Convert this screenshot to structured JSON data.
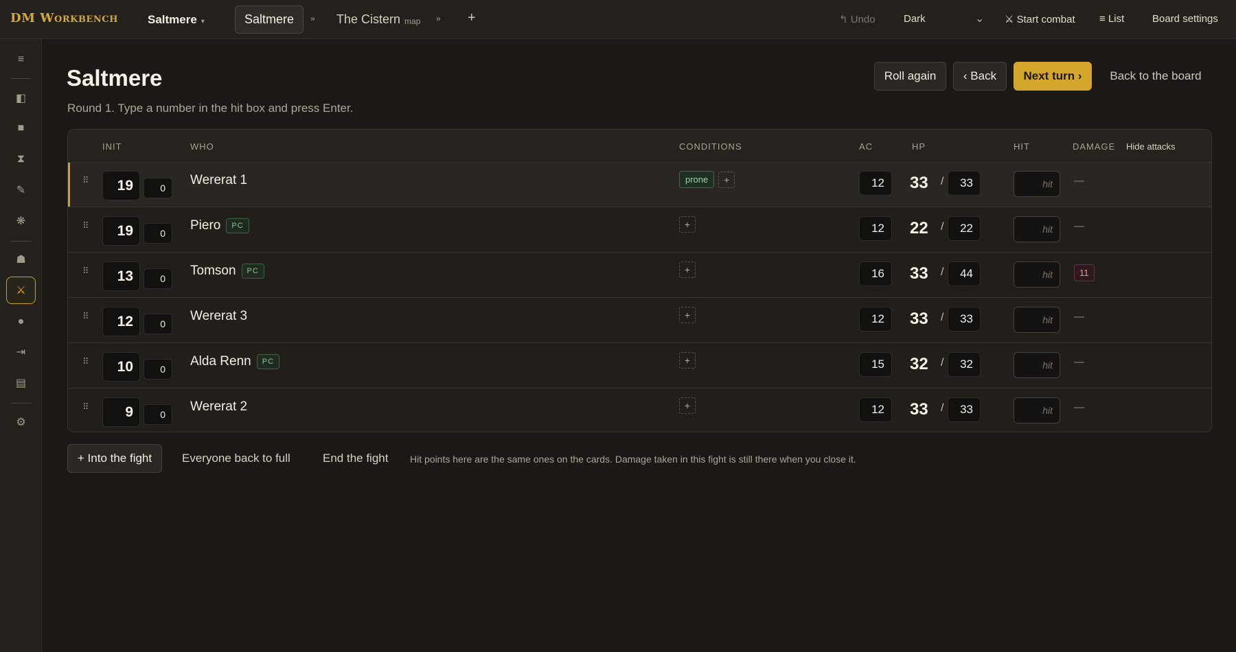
{
  "topbar": {
    "brand": "DM Workbench",
    "campaign": "Saltmere",
    "tabs": [
      {
        "label": "Saltmere",
        "sub": ""
      },
      {
        "label": "The Cistern",
        "sub": "map"
      }
    ],
    "undo": "Undo",
    "theme": "Dark",
    "start_combat": "Start combat",
    "list": "List",
    "board_settings": "Board settings"
  },
  "sidebar": {
    "items": [
      "menu-icon",
      "panel-icon",
      "square-icon",
      "hourglass-icon",
      "pencil-icon",
      "sparkle-icon",
      "helmet-icon",
      "swords-icon",
      "dot-icon",
      "arrow-to-bar-icon",
      "notes-icon",
      "gear-icon"
    ],
    "active": "swords-icon"
  },
  "header": {
    "title": "Saltmere",
    "subtitle": "Round 1. Type a number in the hit box and press Enter.",
    "roll_again": "Roll again",
    "back": "‹ Back",
    "next_turn": "Next turn ›",
    "back_to_board": "Back to the board"
  },
  "table": {
    "columns": {
      "init": "Init",
      "who": "Who",
      "conditions": "Conditions",
      "ac": "AC",
      "hp": "HP",
      "hit": "Hit",
      "damage": "Damage",
      "hide_attacks": "Hide attacks"
    },
    "hit_placeholder": "hit",
    "rows": [
      {
        "init": "19",
        "mod": "0",
        "name": "Wererat 1",
        "pc": "",
        "condition": "prone",
        "ac": "12",
        "hp": "33",
        "max": "33",
        "damage": "—",
        "current": true
      },
      {
        "init": "19",
        "mod": "0",
        "name": "Piero",
        "pc": "PC",
        "condition": "",
        "ac": "12",
        "hp": "22",
        "max": "22",
        "damage": "—",
        "current": false
      },
      {
        "init": "13",
        "mod": "0",
        "name": "Tomson",
        "pc": "PC",
        "condition": "",
        "ac": "16",
        "hp": "33",
        "max": "44",
        "damage": "11",
        "current": false
      },
      {
        "init": "12",
        "mod": "0",
        "name": "Wererat 3",
        "pc": "",
        "condition": "",
        "ac": "12",
        "hp": "33",
        "max": "33",
        "damage": "—",
        "current": false
      },
      {
        "init": "10",
        "mod": "0",
        "name": "Alda Renn",
        "pc": "PC",
        "condition": "",
        "ac": "15",
        "hp": "32",
        "max": "32",
        "damage": "—",
        "current": false
      },
      {
        "init": "9",
        "mod": "0",
        "name": "Wererat 2",
        "pc": "",
        "condition": "",
        "ac": "12",
        "hp": "33",
        "max": "33",
        "damage": "—",
        "current": false
      }
    ]
  },
  "footer": {
    "into_fight": "+ Into the fight",
    "back_to_full": "Everyone back to full",
    "end_fight": "End the fight",
    "note": "Hit points here are the same ones on the cards. Damage taken in this fight is still there when you close it."
  }
}
